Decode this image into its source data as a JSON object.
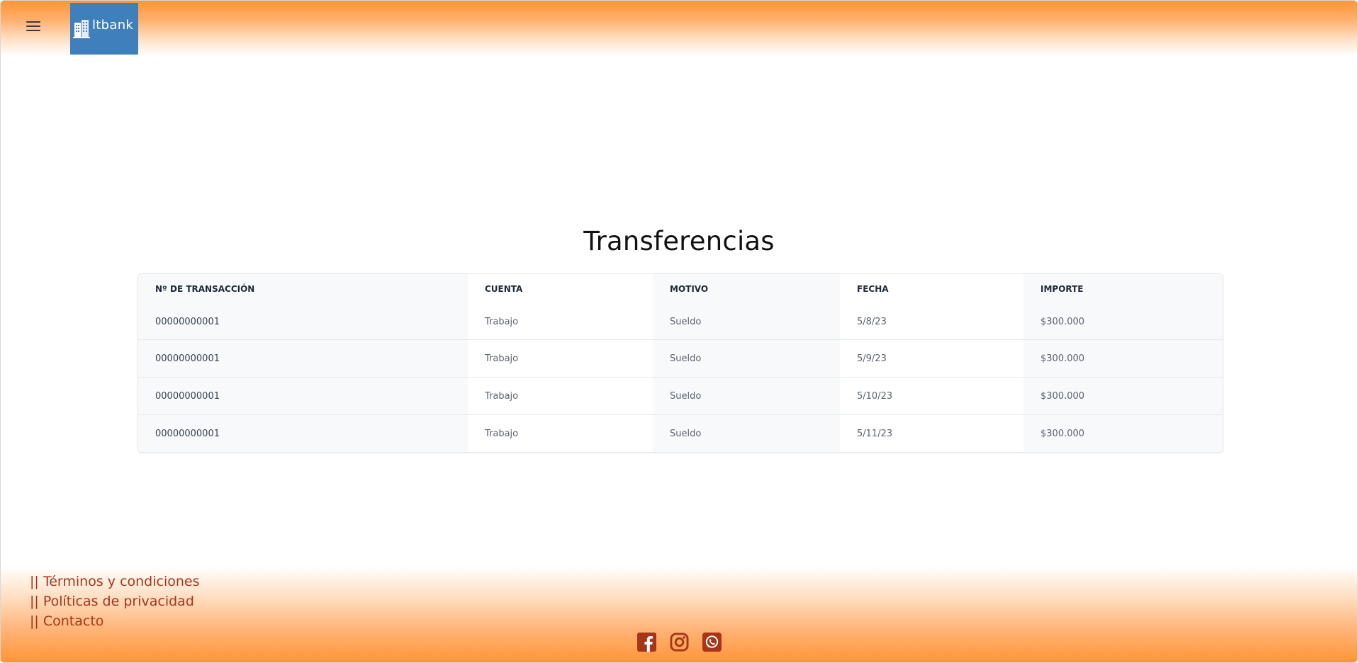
{
  "header": {
    "menu_icon": "hamburger-menu-icon",
    "logo_text": "ltbank",
    "logo_color": "#3f7fbb"
  },
  "main": {
    "title": "Transferencias",
    "table": {
      "columns": [
        "Nº DE TRANSACCIÓN",
        "CUENTA",
        "MOTIVO",
        "FECHA",
        "IMPORTE"
      ],
      "rows": [
        [
          "00000000001",
          "Trabajo",
          "Sueldo",
          "5/8/23",
          "$300.000"
        ],
        [
          "00000000001",
          "Trabajo",
          "Sueldo",
          "5/9/23",
          "$300.000"
        ],
        [
          "00000000001",
          "Trabajo",
          "Sueldo",
          "5/10/23",
          "$300.000"
        ],
        [
          "00000000001",
          "Trabajo",
          "Sueldo",
          "5/11/23",
          "$300.000"
        ]
      ]
    }
  },
  "footer": {
    "links": [
      "|| Términos y condiciones",
      "|| Políticas de privacidad",
      "|| Contacto"
    ],
    "socials": [
      "facebook-icon",
      "instagram-icon",
      "whatsapp-icon"
    ],
    "accent_color": "#a5361a",
    "gradient_color": "#ff9436"
  }
}
